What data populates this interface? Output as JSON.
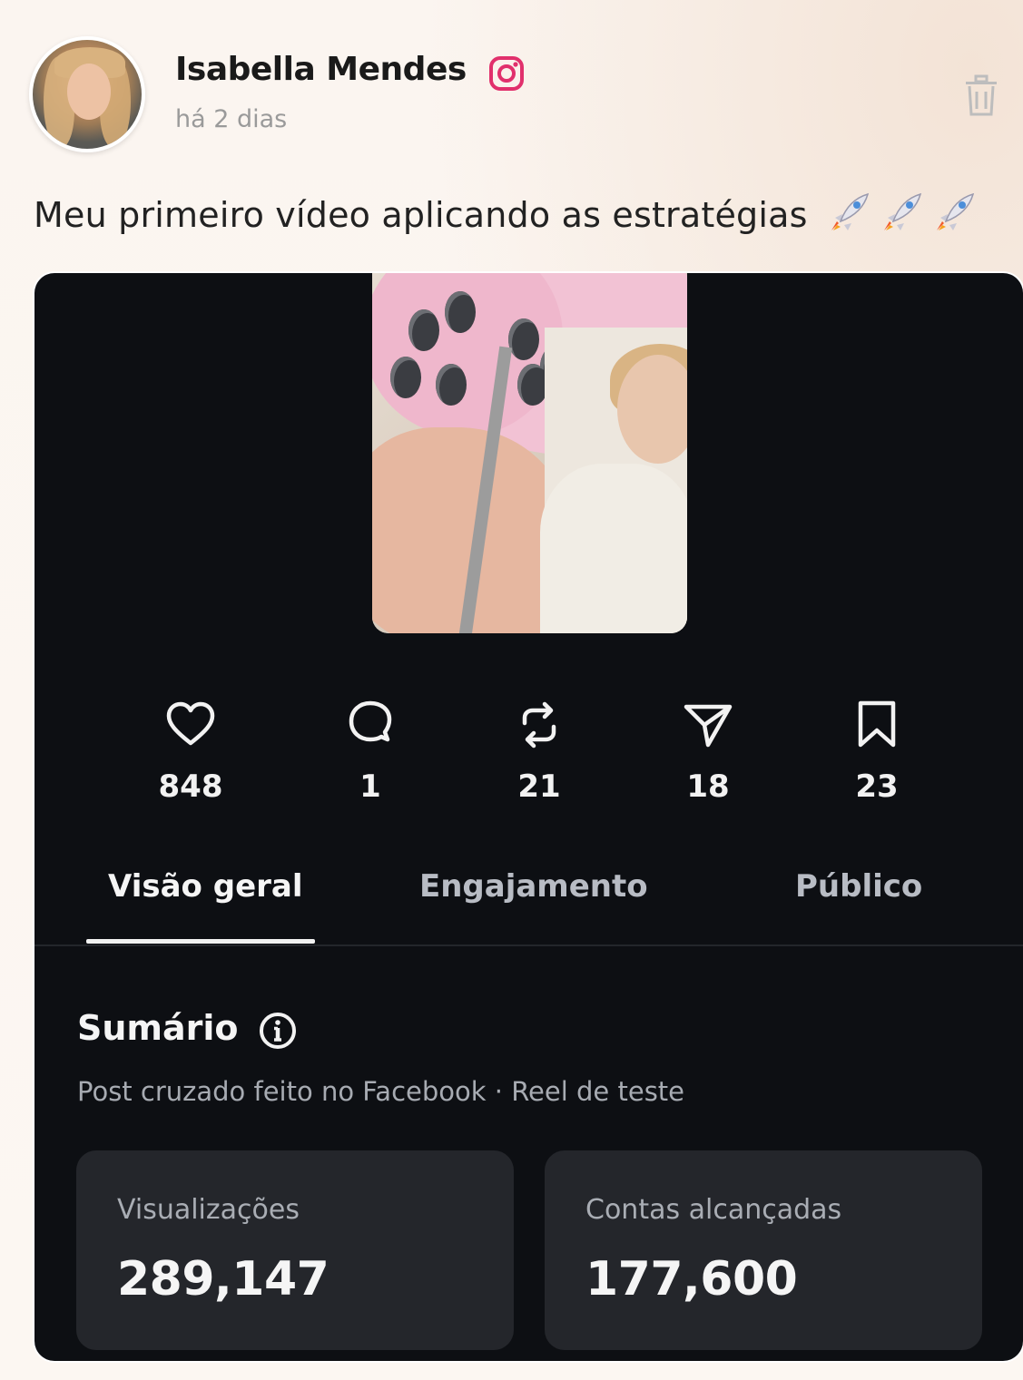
{
  "post": {
    "author": "Isabella Mendes",
    "timestamp": "há 2 dias",
    "caption": "Meu primeiro vídeo aplicando as estratégias"
  },
  "icons": {
    "platform": "instagram-icon",
    "delete": "trash-icon",
    "caption_emoji": "rocket-icon"
  },
  "insights": {
    "stats": [
      {
        "icon": "heart-icon",
        "value": "848"
      },
      {
        "icon": "comment-icon",
        "value": "1"
      },
      {
        "icon": "repost-icon",
        "value": "21"
      },
      {
        "icon": "share-icon",
        "value": "18"
      },
      {
        "icon": "bookmark-icon",
        "value": "23"
      }
    ],
    "tabs": [
      "Visão geral",
      "Engajamento",
      "Público"
    ],
    "active_tab": "Visão geral",
    "summary": {
      "title": "Sumário",
      "subtitle": "Post cruzado feito no Facebook · Reel de teste"
    },
    "metrics": [
      {
        "label": "Visualizações",
        "value": "289,147"
      },
      {
        "label": "Contas alcançadas",
        "value": "177,600"
      }
    ]
  },
  "colors": {
    "instagram_pink": "#e1306c",
    "dark_panel": "#0d0f13",
    "metric_card": "#24262b"
  }
}
